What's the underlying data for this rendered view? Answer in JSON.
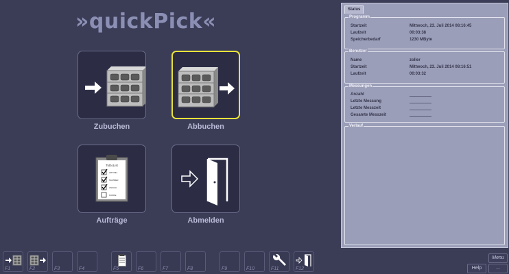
{
  "app": {
    "title": "»quickPick«"
  },
  "tiles": {
    "zubuchen": "Zubuchen",
    "abbuchen": "Abbuchen",
    "auftraege": "Aufträge",
    "abmelden": "Abmelden"
  },
  "status": {
    "tab": "Status",
    "programm": {
      "title": "Programm",
      "rows": [
        {
          "key": "Startzeit",
          "value": "Mittwoch, 23. Juli 2014 08:16:45"
        },
        {
          "key": "Laufzeit",
          "value": "00:03:38"
        },
        {
          "key": "Speicherbedarf",
          "value": "1230 MByte"
        }
      ]
    },
    "benutzer": {
      "title": "Benutzer",
      "rows": [
        {
          "key": "Name",
          "value": "zoller"
        },
        {
          "key": "Startzeit",
          "value": "Mittwoch, 23. Juli 2014 08:16:51"
        },
        {
          "key": "Laufzeit",
          "value": "00:03:32"
        }
      ]
    },
    "messungen": {
      "title": "Messungen",
      "rows": [
        {
          "key": "Anzahl"
        },
        {
          "key": "Letzte Messung"
        },
        {
          "key": "Letzte Messzeit"
        },
        {
          "key": "Gesamte Messzeit"
        }
      ]
    },
    "verlauf": {
      "title": "Verlauf"
    }
  },
  "fkeys": [
    "F1",
    "F2",
    "F3",
    "F4",
    "F5",
    "F6",
    "F7",
    "F8",
    "F9",
    "F10",
    "F11",
    "F12"
  ],
  "buttons": {
    "menu": "Menu",
    "help": "Help",
    "more": "..."
  },
  "clipboard": {
    "heading": "ToDoList",
    "items": [
      "ARTIKEL",
      "NUMMER",
      "ANZAHL",
      "KUNDE"
    ]
  }
}
